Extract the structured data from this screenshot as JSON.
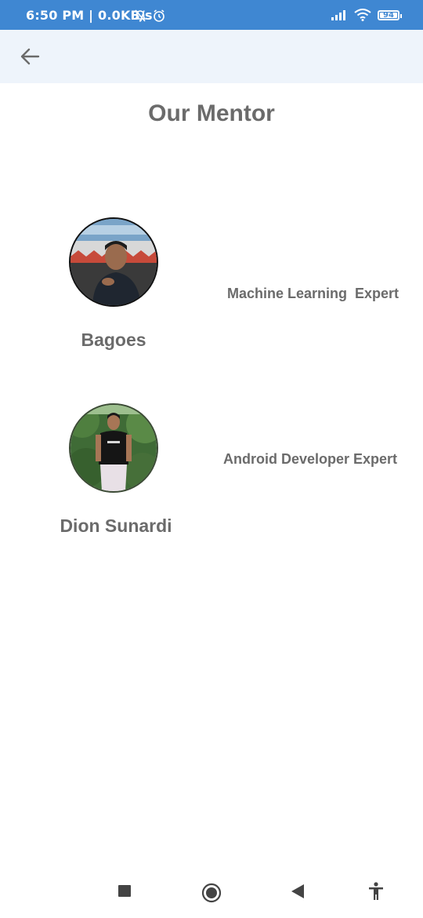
{
  "status_bar": {
    "time": "6:50 PM | 0.0KB/s",
    "battery": "94"
  },
  "app_bar": {
    "back_icon": "arrow-left-icon"
  },
  "page": {
    "title": "Our Mentor"
  },
  "mentors": [
    {
      "name": "Bagoes",
      "role": "Machine Learning  Expert"
    },
    {
      "name": "Dion Sunardi",
      "role": "Android Developer Expert"
    }
  ],
  "nav_bar": {
    "icons": [
      "recents-square-icon",
      "home-circle-icon",
      "back-triangle-icon",
      "accessibility-icon"
    ]
  },
  "colors": {
    "status_bar": "#3f87d2",
    "app_bar": "#eef4fb",
    "text": "#6b6b6b"
  }
}
